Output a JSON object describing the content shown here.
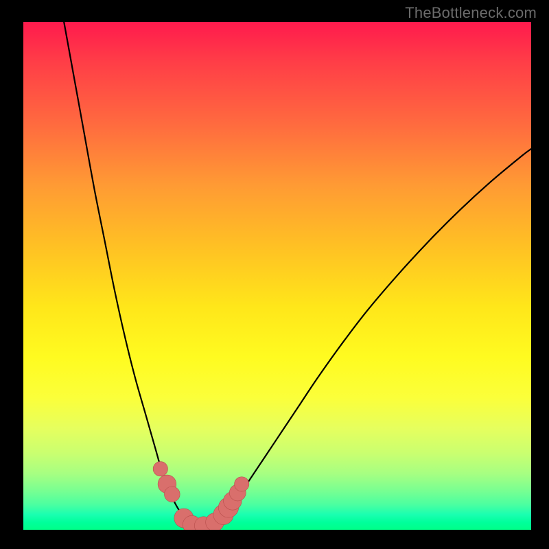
{
  "watermark": "TheBottleneck.com",
  "colors": {
    "frame": "#000000",
    "curve": "#000000",
    "dot_fill": "#d96f6c",
    "dot_stroke": "#b84e4b"
  },
  "chart_data": {
    "type": "line",
    "title": "",
    "xlabel": "",
    "ylabel": "",
    "xlim": [
      0,
      100
    ],
    "ylim": [
      0,
      100
    ],
    "grid": false,
    "legend": false,
    "series": [
      {
        "name": "left-branch",
        "x": [
          8,
          10,
          12,
          14,
          16,
          18,
          20,
          22,
          24,
          26,
          27,
          28,
          29,
          30,
          31,
          31.7
        ],
        "y": [
          100,
          89,
          78,
          67,
          57,
          47,
          38,
          30,
          23,
          16,
          12.5,
          9.5,
          7,
          5,
          3.3,
          2.2
        ]
      },
      {
        "name": "valley",
        "x": [
          31.7,
          33,
          34.5,
          36,
          37.5,
          38.8
        ],
        "y": [
          2.2,
          1.2,
          0.8,
          0.8,
          1.2,
          2.2
        ]
      },
      {
        "name": "right-branch",
        "x": [
          38.8,
          40,
          42,
          44,
          47,
          50,
          54,
          58,
          63,
          68,
          74,
          80,
          86,
          92,
          98,
          100
        ],
        "y": [
          2.2,
          3.5,
          6,
          9,
          13.5,
          18,
          24,
          30,
          37,
          43.5,
          50.5,
          57,
          63,
          68.5,
          73.5,
          75
        ]
      }
    ],
    "markers": [
      {
        "x": 27.0,
        "y": 12.0,
        "r": 1.0
      },
      {
        "x": 28.3,
        "y": 9.0,
        "r": 1.4
      },
      {
        "x": 29.3,
        "y": 7.0,
        "r": 1.1
      },
      {
        "x": 31.6,
        "y": 2.3,
        "r": 1.5
      },
      {
        "x": 33.2,
        "y": 1.0,
        "r": 1.4
      },
      {
        "x": 35.5,
        "y": 0.8,
        "r": 1.4
      },
      {
        "x": 37.7,
        "y": 1.5,
        "r": 1.4
      },
      {
        "x": 39.4,
        "y": 3.0,
        "r": 1.6
      },
      {
        "x": 40.4,
        "y": 4.4,
        "r": 1.6
      },
      {
        "x": 41.2,
        "y": 5.7,
        "r": 1.4
      },
      {
        "x": 42.2,
        "y": 7.3,
        "r": 1.2
      },
      {
        "x": 43.0,
        "y": 9.0,
        "r": 1.0
      }
    ]
  }
}
